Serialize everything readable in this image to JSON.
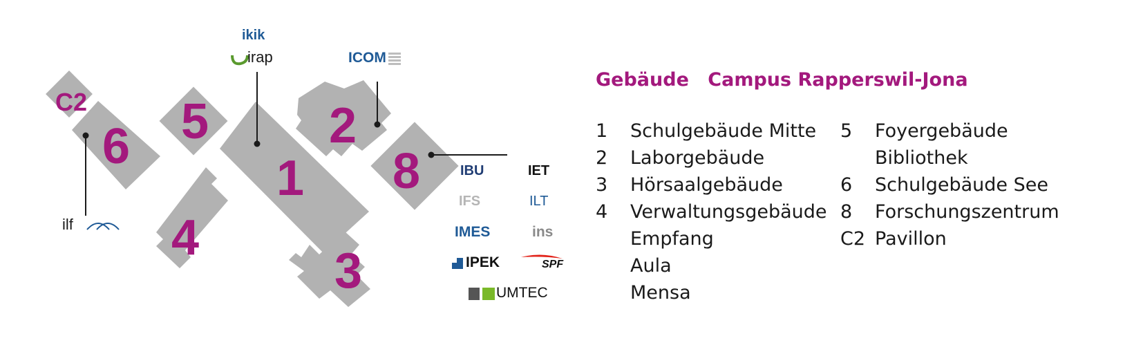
{
  "map": {
    "buildings": [
      {
        "id": "1",
        "label": "1"
      },
      {
        "id": "2",
        "label": "2"
      },
      {
        "id": "3",
        "label": "3"
      },
      {
        "id": "4",
        "label": "4"
      },
      {
        "id": "5",
        "label": "5"
      },
      {
        "id": "6",
        "label": "6"
      },
      {
        "id": "8",
        "label": "8"
      },
      {
        "id": "C2",
        "label": "C2"
      }
    ],
    "institute_logos": [
      "ikik",
      "irap",
      "ICOM",
      "ilf",
      "IBU",
      "IET",
      "IFS",
      "ILT",
      "IMES",
      "ins",
      "IPEK",
      "SPF",
      "UMTEC"
    ]
  },
  "legend": {
    "title_part1": "Gebäude",
    "title_part2": "Campus Rapperswil-Jona",
    "left_column": [
      {
        "num": "1",
        "name": "Schulgebäude Mitte"
      },
      {
        "num": "2",
        "name": "Laborgebäude"
      },
      {
        "num": "3",
        "name": "Hörsaalgebäude"
      },
      {
        "num": "4",
        "name": "Verwaltungsgebäude"
      },
      {
        "num": "",
        "name": "Empfang"
      },
      {
        "num": "",
        "name": "Aula"
      },
      {
        "num": "",
        "name": "Mensa"
      }
    ],
    "right_column": [
      {
        "num": "5",
        "name": "Foyergebäude"
      },
      {
        "num": "",
        "name": "Bibliothek"
      },
      {
        "num": "6",
        "name": "Schulgebäude See"
      },
      {
        "num": "8",
        "name": "Forschungszentrum"
      },
      {
        "num": "C2",
        "name": "Pavillon"
      }
    ]
  },
  "colors": {
    "accent": "#a3197d",
    "building": "#b2b2b2",
    "text": "#1a1a1a",
    "logo_blue": "#1f5a96"
  }
}
